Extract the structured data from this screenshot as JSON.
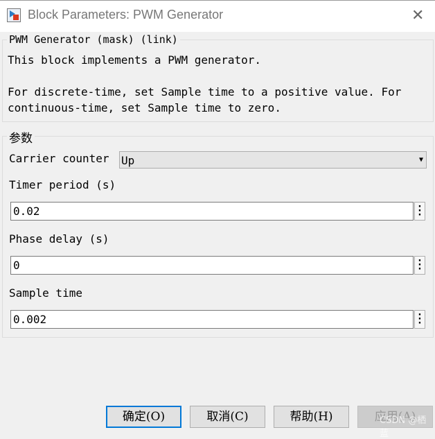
{
  "window": {
    "title": "Block Parameters: PWM Generator",
    "close_icon": "close-icon",
    "app_icon": "simulink-block-icon"
  },
  "description": {
    "group_title": "PWM Generator (mask) (link)",
    "line1": "This block implements a PWM generator.",
    "line2": "For discrete-time, set Sample time to a positive value. For",
    "line3": "continuous-time, set Sample time to zero."
  },
  "params": {
    "group_title": "参数",
    "carrier_counter": {
      "label": "Carrier counter",
      "value": "Up"
    },
    "timer_period": {
      "label": "Timer period (s)",
      "value": "0.02"
    },
    "phase_delay": {
      "label": "Phase delay (s)",
      "value": "0"
    },
    "sample_time": {
      "label": "Sample time",
      "value": "0.002"
    }
  },
  "buttons": {
    "ok": "确定(O)",
    "cancel": "取消(C)",
    "help": "帮助(H)",
    "apply": "应用(A)"
  },
  "watermark": "CSDN @栖蓝"
}
